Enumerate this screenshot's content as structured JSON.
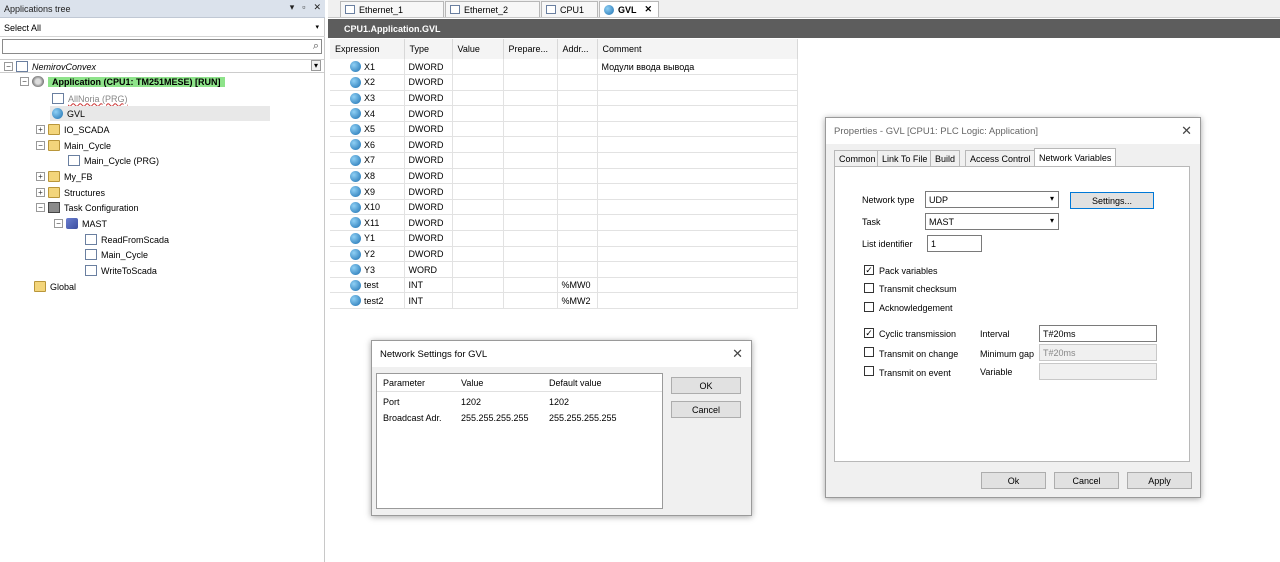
{
  "left_panel": {
    "title": "Applications tree",
    "pin": "▾",
    "pin2": "ᵖ",
    "close": "✕",
    "select_all": "Select All",
    "tree": {
      "root": "NemirovConvex",
      "application": "Application (CPU1: TM251MESE) [RUN]",
      "items": [
        "AllNoria (PRG)",
        "GVL",
        "IO_SCADA",
        "Main_Cycle",
        "Main_Cycle (PRG)",
        "My_FB",
        "Structures",
        "Task Configuration",
        "MAST",
        "ReadFromScada",
        "Main_Cycle",
        "WriteToScada",
        "Global"
      ]
    }
  },
  "tabs": [
    "Ethernet_1",
    "Ethernet_2",
    "CPU1",
    "GVL"
  ],
  "tab_close": "✕",
  "doc_title": "CPU1.Application.GVL",
  "table": {
    "headers": [
      "Expression",
      "Type",
      "Value",
      "Prepare...",
      "Addr...",
      "Comment"
    ],
    "rows": [
      [
        "X1",
        "DWORD",
        "",
        "",
        "",
        "Модули ввода вывода"
      ],
      [
        "X2",
        "DWORD",
        "",
        "",
        "",
        ""
      ],
      [
        "X3",
        "DWORD",
        "",
        "",
        "",
        ""
      ],
      [
        "X4",
        "DWORD",
        "",
        "",
        "",
        ""
      ],
      [
        "X5",
        "DWORD",
        "",
        "",
        "",
        ""
      ],
      [
        "X6",
        "DWORD",
        "",
        "",
        "",
        ""
      ],
      [
        "X7",
        "DWORD",
        "",
        "",
        "",
        ""
      ],
      [
        "X8",
        "DWORD",
        "",
        "",
        "",
        ""
      ],
      [
        "X9",
        "DWORD",
        "",
        "",
        "",
        ""
      ],
      [
        "X10",
        "DWORD",
        "",
        "",
        "",
        ""
      ],
      [
        "X11",
        "DWORD",
        "",
        "",
        "",
        ""
      ],
      [
        "Y1",
        "DWORD",
        "",
        "",
        "",
        ""
      ],
      [
        "Y2",
        "DWORD",
        "",
        "",
        "",
        ""
      ],
      [
        "Y3",
        "WORD",
        "",
        "",
        "",
        ""
      ],
      [
        "test",
        "INT",
        "",
        "",
        "%MW0",
        ""
      ],
      [
        "test2",
        "INT",
        "",
        "",
        "%MW2",
        ""
      ]
    ]
  },
  "net_dialog": {
    "title": "Network Settings for GVL",
    "headers": [
      "Parameter",
      "Value",
      "Default value"
    ],
    "rows": [
      [
        "Port",
        "1202",
        "1202"
      ],
      [
        "Broadcast Adr.",
        "255.255.255.255",
        "255.255.255.255"
      ]
    ],
    "ok": "OK",
    "cancel": "Cancel"
  },
  "prop_dialog": {
    "title": "Properties - GVL [CPU1: PLC Logic: Application]",
    "tabs": [
      "Common",
      "Link To File",
      "Build",
      "Access Control",
      "Network Variables"
    ],
    "network_type_label": "Network type",
    "network_type": "UDP",
    "settings_btn": "Settings...",
    "task_label": "Task",
    "task": "MAST",
    "list_id_label": "List identifier",
    "list_id": "1",
    "pack_variables": "Pack variables",
    "transmit_checksum": "Transmit checksum",
    "acknowledgement": "Acknowledgement",
    "cyclic_transmission": "Cyclic transmission",
    "interval_label": "Interval",
    "interval": "T#20ms",
    "transmit_on_change": "Transmit on change",
    "min_gap_label": "Minimum gap",
    "min_gap": "T#20ms",
    "transmit_on_event": "Transmit on event",
    "variable_label": "Variable",
    "ok": "Ok",
    "cancel": "Cancel",
    "apply": "Apply"
  },
  "icons": {
    "check": "✓",
    "expand": "+",
    "collapse": "−",
    "search": "⌕",
    "dropdown": "▾",
    "close": "✕"
  }
}
